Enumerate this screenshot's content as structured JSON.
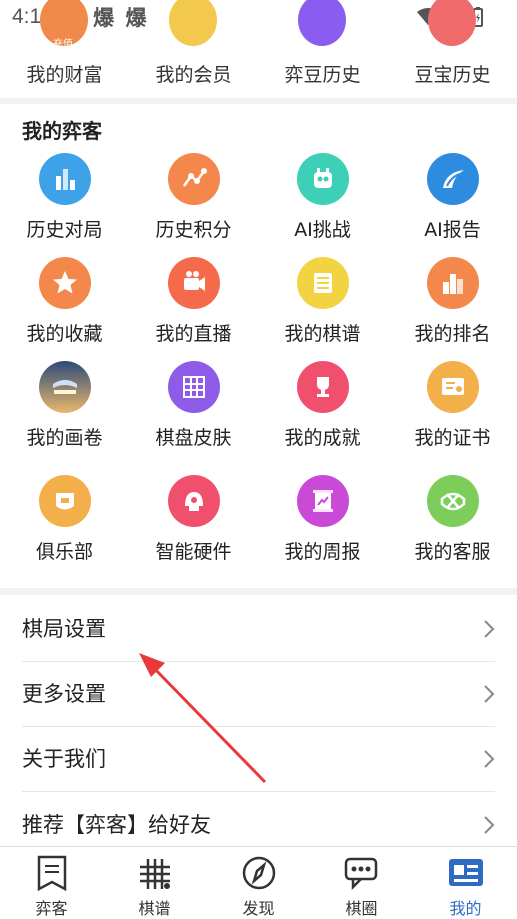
{
  "status_bar": {
    "time": "4:13",
    "indicators": "爆 爆 爆"
  },
  "wealth": {
    "badge": "充值",
    "items": [
      {
        "label": "我的财富",
        "color": "#f08a4b"
      },
      {
        "label": "我的会员",
        "color": "#f2c94c"
      },
      {
        "label": "弈豆历史",
        "color": "#8a5cf0"
      },
      {
        "label": "豆宝历史",
        "color": "#f06b6b"
      }
    ]
  },
  "my_yike": {
    "title": "我的弈客",
    "items": [
      {
        "label": "历史对局",
        "icon": "history-games-icon",
        "color": "#3ea2e8"
      },
      {
        "label": "历史积分",
        "icon": "history-score-icon",
        "color": "#f4874b"
      },
      {
        "label": "AI挑战",
        "icon": "ai-challenge-icon",
        "color": "#3ecfb7"
      },
      {
        "label": "AI报告",
        "icon": "ai-report-icon",
        "color": "#2e8ce0"
      },
      {
        "label": "我的收藏",
        "icon": "favorites-icon",
        "color": "#f4874b"
      },
      {
        "label": "我的直播",
        "icon": "live-icon",
        "color": "#f56a4a"
      },
      {
        "label": "我的棋谱",
        "icon": "game-records-icon",
        "color": "#f2d341"
      },
      {
        "label": "我的排名",
        "icon": "ranking-icon",
        "color": "#f4874b"
      },
      {
        "label": "我的画卷",
        "icon": "scroll-painting-icon",
        "color": "#e9b86b"
      },
      {
        "label": "棋盘皮肤",
        "icon": "board-skin-icon",
        "color": "#8e5ce8"
      },
      {
        "label": "我的成就",
        "icon": "achievements-icon",
        "color": "#f0506e"
      },
      {
        "label": "我的证书",
        "icon": "certificate-icon",
        "color": "#f3b04a"
      },
      {
        "label": "俱乐部",
        "icon": "club-icon",
        "color": "#f3b04a"
      },
      {
        "label": "智能硬件",
        "icon": "smart-hardware-icon",
        "color": "#f0506e"
      },
      {
        "label": "我的周报",
        "icon": "weekly-report-icon",
        "color": "#c94ad6"
      },
      {
        "label": "我的客服",
        "icon": "customer-service-icon",
        "color": "#7ccd5a"
      }
    ]
  },
  "settings": [
    {
      "label": "棋局设置"
    },
    {
      "label": "更多设置"
    },
    {
      "label": "关于我们"
    },
    {
      "label": "推荐【弈客】给好友"
    }
  ],
  "tabs": [
    {
      "label": "弈客",
      "icon": "book-icon",
      "active": false
    },
    {
      "label": "棋谱",
      "icon": "grid-board-icon",
      "active": false
    },
    {
      "label": "发现",
      "icon": "compass-icon",
      "active": false
    },
    {
      "label": "棋圈",
      "icon": "chat-bubble-icon",
      "active": false
    },
    {
      "label": "我的",
      "icon": "profile-card-icon",
      "active": true
    }
  ],
  "colors": {
    "accent": "#2e6cc4",
    "annotation": "#e83a3a"
  }
}
